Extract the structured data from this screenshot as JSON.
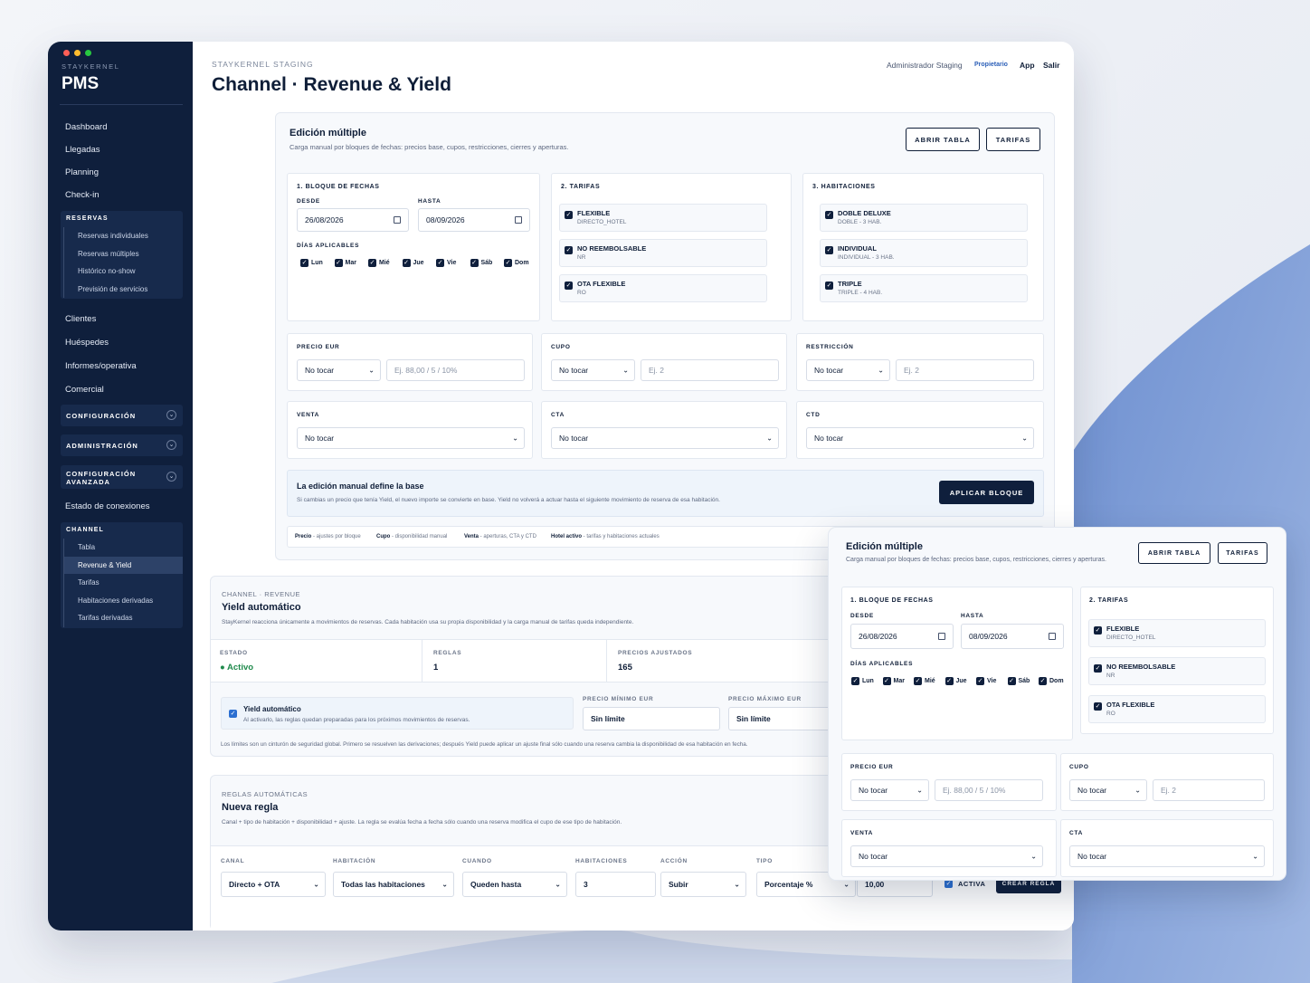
{
  "window_dots": [
    "#ff5f57",
    "#febc2e",
    "#28c840"
  ],
  "sidebar": {
    "brand_small": "STAYKERNEL",
    "brand": "PMS",
    "nav_top": [
      "Dashboard",
      "Llegadas",
      "Planning",
      "Check-in"
    ],
    "reservas": {
      "title": "RESERVAS",
      "items": [
        "Reservas individuales",
        "Reservas múltiples",
        "Histórico no-show",
        "Previsión de servicios"
      ]
    },
    "nav_mid": [
      "Clientes",
      "Huéspedes",
      "Informes/operativa",
      "Comercial"
    ],
    "sections": [
      "CONFIGURACIÓN",
      "ADMINISTRACIÓN",
      "CONFIGURACIÓN AVANZADA"
    ],
    "estado": "Estado de conexiones",
    "channel": {
      "title": "CHANNEL",
      "items": [
        "Tabla",
        "Revenue & Yield",
        "Tarifas",
        "Habitaciones derivadas",
        "Tarifas derivadas"
      ],
      "active": "Revenue & Yield"
    }
  },
  "header": {
    "subtitle": "STAYKERNEL STAGING",
    "title": "Channel · Revenue & Yield",
    "user": "Administrador Staging",
    "role": "Propietario",
    "app_link": "App",
    "logout": "Salir"
  },
  "bulk": {
    "title": "Edición múltiple",
    "desc": "Carga manual por bloques de fechas: precios base, cupos, restricciones, cierres y aperturas.",
    "btn_table": "ABRIR TABLA",
    "btn_rates": "TARIFAS",
    "dates_title": "1. BLOQUE DE FECHAS",
    "from_label": "DESDE",
    "from_value": "26/08/2026",
    "to_label": "HASTA",
    "to_value": "08/09/2026",
    "days_label": "DÍAS APLICABLES",
    "days": [
      "Lun",
      "Mar",
      "Mié",
      "Jue",
      "Vie",
      "Sáb",
      "Dom"
    ],
    "rates_title": "2. TARIFAS",
    "rates": [
      {
        "name": "FLEXIBLE",
        "code": "DIRECTO_HOTEL"
      },
      {
        "name": "NO REEMBOLSABLE",
        "code": "NR"
      },
      {
        "name": "OTA FLEXIBLE",
        "code": "RO"
      }
    ],
    "rooms_title": "3. HABITACIONES",
    "rooms": [
      {
        "name": "DOBLE DELUXE",
        "code": "DOBLE - 3 HAB."
      },
      {
        "name": "INDIVIDUAL",
        "code": "INDIVIDUAL - 3 HAB."
      },
      {
        "name": "TRIPLE",
        "code": "TRIPLE - 4 HAB."
      }
    ],
    "price_label": "PRECIO EUR",
    "quota_label": "CUPO",
    "restriction_label": "RESTRICCIÓN",
    "sale_label": "VENTA",
    "cta_label": "CTA",
    "ctd_label": "CTD",
    "no_touch": "No tocar",
    "price_placeholder": "Ej. 88,00 / 5 / 10%",
    "quota_placeholder": "Ej. 2",
    "restriction_placeholder": "Ej. 2",
    "notice_title": "La edición manual define la base",
    "notice_text": "Si cambias un precio que tenía Yield, el nuevo importe se convierte en base. Yield no volverá a actuar hasta el siguiente movimiento de reserva de esa habitación.",
    "apply_btn": "APLICAR BLOQUE",
    "legend": [
      {
        "b": "Precio",
        "t": " - ajustes por bloque"
      },
      {
        "b": "Cupo",
        "t": " - disponibilidad manual"
      },
      {
        "b": "Venta",
        "t": " - aperturas, CTA y CTD"
      },
      {
        "b": "Hotel activo",
        "t": " - tarifas y habitaciones actuales"
      }
    ]
  },
  "yield": {
    "eyebrow": "CHANNEL · REVENUE",
    "title": "Yield automático",
    "desc": "StayKernel reacciona únicamente a movimientos de reservas. Cada habitación usa su propia disponibilidad y la carga manual de tarifas queda independiente.",
    "state_label": "ESTADO",
    "state_value": "● Activo",
    "rules_label": "REGLAS",
    "rules_value": "1",
    "adjusted_label": "PRECIOS AJUSTADOS",
    "adjusted_value": "165",
    "auto_title": "Yield automático",
    "auto_desc": "Al activarlo, las reglas quedan preparadas para los próximos movimientos de reservas.",
    "min_label": "PRECIO MÍNIMO EUR",
    "min_value": "Sin límite",
    "max_label": "PRECIO MÁXIMO EUR",
    "max_value": "Sin límite",
    "footnote": "Los límites son un cinturón de seguridad global. Primero se resuelven las derivaciones; después Yield puede aplicar un ajuste final sólo cuando una reserva cambia la disponibilidad de esa habitación en fecha."
  },
  "rules": {
    "eyebrow": "REGLAS AUTOMÁTICAS",
    "title": "Nueva regla",
    "desc": "Canal + tipo de habitación + disponibilidad + ajuste. La regla se evalúa fecha a fecha sólo cuando una reserva modifica el cupo de ese tipo de habitación.",
    "fields": [
      {
        "label": "CANAL",
        "value": "Directo + OTA"
      },
      {
        "label": "HABITACIÓN",
        "value": "Todas las habitaciones"
      },
      {
        "label": "CUANDO",
        "value": "Queden hasta"
      },
      {
        "label": "HABITACIONES",
        "value": "3"
      },
      {
        "label": "ACCIÓN",
        "value": "Subir"
      },
      {
        "label": "TIPO",
        "value": "Porcentaje %"
      }
    ],
    "amount": "10,00",
    "active_label": "ACTIVA",
    "create_btn": "CREAR REGLA"
  }
}
